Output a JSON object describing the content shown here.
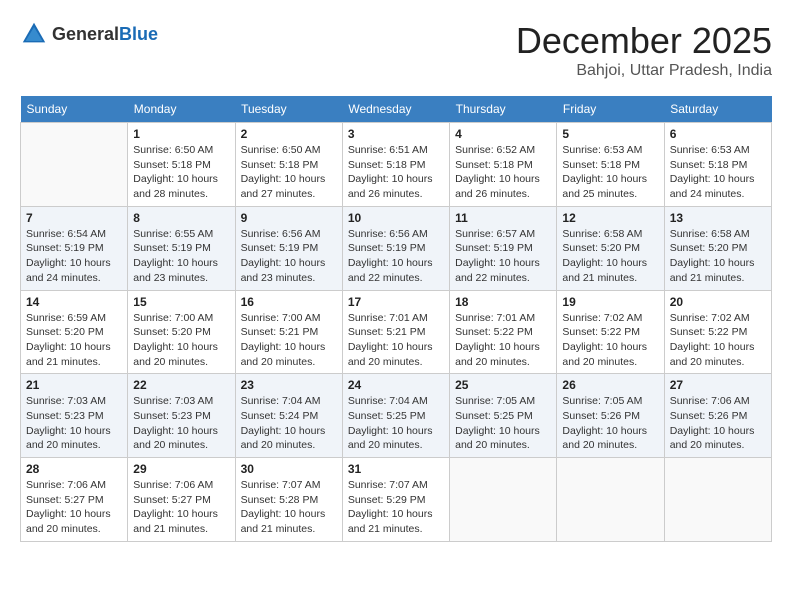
{
  "logo": {
    "text_general": "General",
    "text_blue": "Blue"
  },
  "header": {
    "month": "December 2025",
    "location": "Bahjoi, Uttar Pradesh, India"
  },
  "weekdays": [
    "Sunday",
    "Monday",
    "Tuesday",
    "Wednesday",
    "Thursday",
    "Friday",
    "Saturday"
  ],
  "weeks": [
    [
      {
        "day": "",
        "info": ""
      },
      {
        "day": "1",
        "info": "Sunrise: 6:50 AM\nSunset: 5:18 PM\nDaylight: 10 hours\nand 28 minutes."
      },
      {
        "day": "2",
        "info": "Sunrise: 6:50 AM\nSunset: 5:18 PM\nDaylight: 10 hours\nand 27 minutes."
      },
      {
        "day": "3",
        "info": "Sunrise: 6:51 AM\nSunset: 5:18 PM\nDaylight: 10 hours\nand 26 minutes."
      },
      {
        "day": "4",
        "info": "Sunrise: 6:52 AM\nSunset: 5:18 PM\nDaylight: 10 hours\nand 26 minutes."
      },
      {
        "day": "5",
        "info": "Sunrise: 6:53 AM\nSunset: 5:18 PM\nDaylight: 10 hours\nand 25 minutes."
      },
      {
        "day": "6",
        "info": "Sunrise: 6:53 AM\nSunset: 5:18 PM\nDaylight: 10 hours\nand 24 minutes."
      }
    ],
    [
      {
        "day": "7",
        "info": "Sunrise: 6:54 AM\nSunset: 5:19 PM\nDaylight: 10 hours\nand 24 minutes."
      },
      {
        "day": "8",
        "info": "Sunrise: 6:55 AM\nSunset: 5:19 PM\nDaylight: 10 hours\nand 23 minutes."
      },
      {
        "day": "9",
        "info": "Sunrise: 6:56 AM\nSunset: 5:19 PM\nDaylight: 10 hours\nand 23 minutes."
      },
      {
        "day": "10",
        "info": "Sunrise: 6:56 AM\nSunset: 5:19 PM\nDaylight: 10 hours\nand 22 minutes."
      },
      {
        "day": "11",
        "info": "Sunrise: 6:57 AM\nSunset: 5:19 PM\nDaylight: 10 hours\nand 22 minutes."
      },
      {
        "day": "12",
        "info": "Sunrise: 6:58 AM\nSunset: 5:20 PM\nDaylight: 10 hours\nand 21 minutes."
      },
      {
        "day": "13",
        "info": "Sunrise: 6:58 AM\nSunset: 5:20 PM\nDaylight: 10 hours\nand 21 minutes."
      }
    ],
    [
      {
        "day": "14",
        "info": "Sunrise: 6:59 AM\nSunset: 5:20 PM\nDaylight: 10 hours\nand 21 minutes."
      },
      {
        "day": "15",
        "info": "Sunrise: 7:00 AM\nSunset: 5:20 PM\nDaylight: 10 hours\nand 20 minutes."
      },
      {
        "day": "16",
        "info": "Sunrise: 7:00 AM\nSunset: 5:21 PM\nDaylight: 10 hours\nand 20 minutes."
      },
      {
        "day": "17",
        "info": "Sunrise: 7:01 AM\nSunset: 5:21 PM\nDaylight: 10 hours\nand 20 minutes."
      },
      {
        "day": "18",
        "info": "Sunrise: 7:01 AM\nSunset: 5:22 PM\nDaylight: 10 hours\nand 20 minutes."
      },
      {
        "day": "19",
        "info": "Sunrise: 7:02 AM\nSunset: 5:22 PM\nDaylight: 10 hours\nand 20 minutes."
      },
      {
        "day": "20",
        "info": "Sunrise: 7:02 AM\nSunset: 5:22 PM\nDaylight: 10 hours\nand 20 minutes."
      }
    ],
    [
      {
        "day": "21",
        "info": "Sunrise: 7:03 AM\nSunset: 5:23 PM\nDaylight: 10 hours\nand 20 minutes."
      },
      {
        "day": "22",
        "info": "Sunrise: 7:03 AM\nSunset: 5:23 PM\nDaylight: 10 hours\nand 20 minutes."
      },
      {
        "day": "23",
        "info": "Sunrise: 7:04 AM\nSunset: 5:24 PM\nDaylight: 10 hours\nand 20 minutes."
      },
      {
        "day": "24",
        "info": "Sunrise: 7:04 AM\nSunset: 5:25 PM\nDaylight: 10 hours\nand 20 minutes."
      },
      {
        "day": "25",
        "info": "Sunrise: 7:05 AM\nSunset: 5:25 PM\nDaylight: 10 hours\nand 20 minutes."
      },
      {
        "day": "26",
        "info": "Sunrise: 7:05 AM\nSunset: 5:26 PM\nDaylight: 10 hours\nand 20 minutes."
      },
      {
        "day": "27",
        "info": "Sunrise: 7:06 AM\nSunset: 5:26 PM\nDaylight: 10 hours\nand 20 minutes."
      }
    ],
    [
      {
        "day": "28",
        "info": "Sunrise: 7:06 AM\nSunset: 5:27 PM\nDaylight: 10 hours\nand 20 minutes."
      },
      {
        "day": "29",
        "info": "Sunrise: 7:06 AM\nSunset: 5:27 PM\nDaylight: 10 hours\nand 21 minutes."
      },
      {
        "day": "30",
        "info": "Sunrise: 7:07 AM\nSunset: 5:28 PM\nDaylight: 10 hours\nand 21 minutes."
      },
      {
        "day": "31",
        "info": "Sunrise: 7:07 AM\nSunset: 5:29 PM\nDaylight: 10 hours\nand 21 minutes."
      },
      {
        "day": "",
        "info": ""
      },
      {
        "day": "",
        "info": ""
      },
      {
        "day": "",
        "info": ""
      }
    ]
  ]
}
